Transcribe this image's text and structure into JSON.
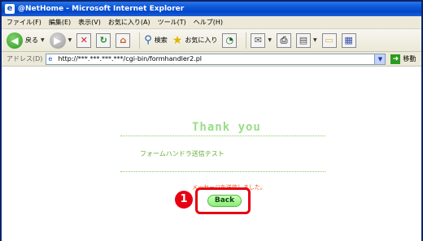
{
  "window": {
    "title": "@NetHome - Microsoft Internet Explorer"
  },
  "menubar": {
    "items": [
      {
        "label": "ファイル(F)"
      },
      {
        "label": "編集(E)"
      },
      {
        "label": "表示(V)"
      },
      {
        "label": "お気に入り(A)"
      },
      {
        "label": "ツール(T)"
      },
      {
        "label": "ヘルプ(H)"
      }
    ]
  },
  "toolbar": {
    "back_label": "戻る",
    "search_label": "検索",
    "favorites_label": "お気に入り"
  },
  "addressbar": {
    "label": "アドレス(D)",
    "url": "http://***.***.***.***/cgi-bin/formhandler2.pl",
    "go_label": "移動"
  },
  "content": {
    "heading": "Thank you",
    "form_name": "フォームハンドラ送信テスト",
    "message": "メッセージを送信しました。",
    "back_button": "Back",
    "step_marker": "1"
  }
}
